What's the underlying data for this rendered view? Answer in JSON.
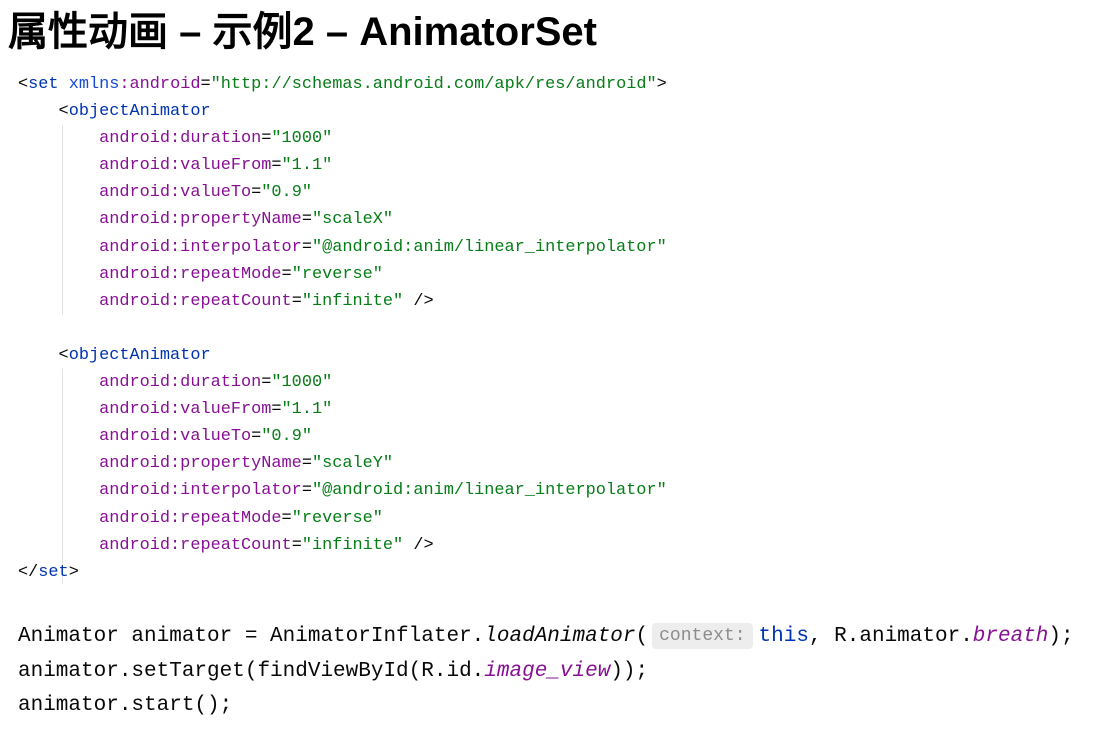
{
  "slide": {
    "title": "属性动画 – 示例2 – AnimatorSet"
  },
  "colors": {
    "background": "#ffffff",
    "text": "#080808",
    "title": "#000000",
    "tag": "#0033B3",
    "namespace": "#174AD4",
    "attr": "#871094",
    "value": "#067D17",
    "keyword": "#0033B3",
    "field": "#871094",
    "hint_text": "#8C8C8C",
    "hint_bg": "#EDEDED",
    "indent_guide": "#E2E2E2"
  },
  "xml_code": {
    "lines": [
      {
        "tokens": [
          {
            "k": "punct",
            "t": "<"
          },
          {
            "k": "tag",
            "t": "set"
          },
          {
            "k": "plain",
            "t": " "
          },
          {
            "k": "ns",
            "t": "xmlns"
          },
          {
            "k": "attr",
            "t": ":android"
          },
          {
            "k": "plain",
            "t": "="
          },
          {
            "k": "value",
            "t": "\"http://schemas.android.com/apk/res/android\""
          },
          {
            "k": "punct",
            "t": ">"
          }
        ]
      },
      {
        "tokens": [
          {
            "k": "punct",
            "t": "    <"
          },
          {
            "k": "tag",
            "t": "objectAnimator"
          }
        ]
      },
      {
        "tokens": [
          {
            "k": "attr",
            "t": "        android:duration"
          },
          {
            "k": "plain",
            "t": "="
          },
          {
            "k": "value",
            "t": "\"1000\""
          }
        ]
      },
      {
        "tokens": [
          {
            "k": "attr",
            "t": "        android:valueFrom"
          },
          {
            "k": "plain",
            "t": "="
          },
          {
            "k": "value",
            "t": "\"1.1\""
          }
        ]
      },
      {
        "tokens": [
          {
            "k": "attr",
            "t": "        android:valueTo"
          },
          {
            "k": "plain",
            "t": "="
          },
          {
            "k": "value",
            "t": "\"0.9\""
          }
        ]
      },
      {
        "tokens": [
          {
            "k": "attr",
            "t": "        android:propertyName"
          },
          {
            "k": "plain",
            "t": "="
          },
          {
            "k": "value",
            "t": "\"scaleX\""
          }
        ]
      },
      {
        "tokens": [
          {
            "k": "attr",
            "t": "        android:interpolator"
          },
          {
            "k": "plain",
            "t": "="
          },
          {
            "k": "value",
            "t": "\"@android:anim/linear_interpolator\""
          }
        ]
      },
      {
        "tokens": [
          {
            "k": "attr",
            "t": "        android:repeatMode"
          },
          {
            "k": "plain",
            "t": "="
          },
          {
            "k": "value",
            "t": "\"reverse\""
          }
        ]
      },
      {
        "tokens": [
          {
            "k": "attr",
            "t": "        android:repeatCount"
          },
          {
            "k": "plain",
            "t": "="
          },
          {
            "k": "value",
            "t": "\"infinite\""
          },
          {
            "k": "punct",
            "t": " />"
          }
        ]
      },
      {
        "tokens": []
      },
      {
        "tokens": [
          {
            "k": "punct",
            "t": "    <"
          },
          {
            "k": "tag",
            "t": "objectAnimator"
          }
        ]
      },
      {
        "tokens": [
          {
            "k": "attr",
            "t": "        android:duration"
          },
          {
            "k": "plain",
            "t": "="
          },
          {
            "k": "value",
            "t": "\"1000\""
          }
        ]
      },
      {
        "tokens": [
          {
            "k": "attr",
            "t": "        android:valueFrom"
          },
          {
            "k": "plain",
            "t": "="
          },
          {
            "k": "value",
            "t": "\"1.1\""
          }
        ]
      },
      {
        "tokens": [
          {
            "k": "attr",
            "t": "        android:valueTo"
          },
          {
            "k": "plain",
            "t": "="
          },
          {
            "k": "value",
            "t": "\"0.9\""
          }
        ]
      },
      {
        "tokens": [
          {
            "k": "attr",
            "t": "        android:propertyName"
          },
          {
            "k": "plain",
            "t": "="
          },
          {
            "k": "value",
            "t": "\"scaleY\""
          }
        ]
      },
      {
        "tokens": [
          {
            "k": "attr",
            "t": "        android:interpolator"
          },
          {
            "k": "plain",
            "t": "="
          },
          {
            "k": "value",
            "t": "\"@android:anim/linear_interpolator\""
          }
        ]
      },
      {
        "tokens": [
          {
            "k": "attr",
            "t": "        android:repeatMode"
          },
          {
            "k": "plain",
            "t": "="
          },
          {
            "k": "value",
            "t": "\"reverse\""
          }
        ]
      },
      {
        "tokens": [
          {
            "k": "attr",
            "t": "        android:repeatCount"
          },
          {
            "k": "plain",
            "t": "="
          },
          {
            "k": "value",
            "t": "\"infinite\""
          },
          {
            "k": "punct",
            "t": " />"
          }
        ]
      },
      {
        "tokens": [
          {
            "k": "punct",
            "t": "</"
          },
          {
            "k": "tag",
            "t": "set"
          },
          {
            "k": "punct",
            "t": ">"
          }
        ]
      }
    ]
  },
  "java_code": {
    "lines": [
      {
        "tokens": [
          {
            "k": "plain",
            "t": "Animator animator = AnimatorInflater."
          },
          {
            "k": "method",
            "t": "loadAnimator"
          },
          {
            "k": "plain",
            "t": "("
          },
          {
            "k": "hint",
            "t": "context:"
          },
          {
            "k": "keyword",
            "t": "this"
          },
          {
            "k": "plain",
            "t": ", R.animator."
          },
          {
            "k": "field",
            "t": "breath"
          },
          {
            "k": "plain",
            "t": ");"
          }
        ]
      },
      {
        "tokens": [
          {
            "k": "plain",
            "t": "animator.setTarget(findViewById(R.id."
          },
          {
            "k": "field",
            "t": "image_view"
          },
          {
            "k": "plain",
            "t": "));"
          }
        ]
      },
      {
        "tokens": [
          {
            "k": "plain",
            "t": "animator.start();"
          }
        ]
      }
    ]
  }
}
